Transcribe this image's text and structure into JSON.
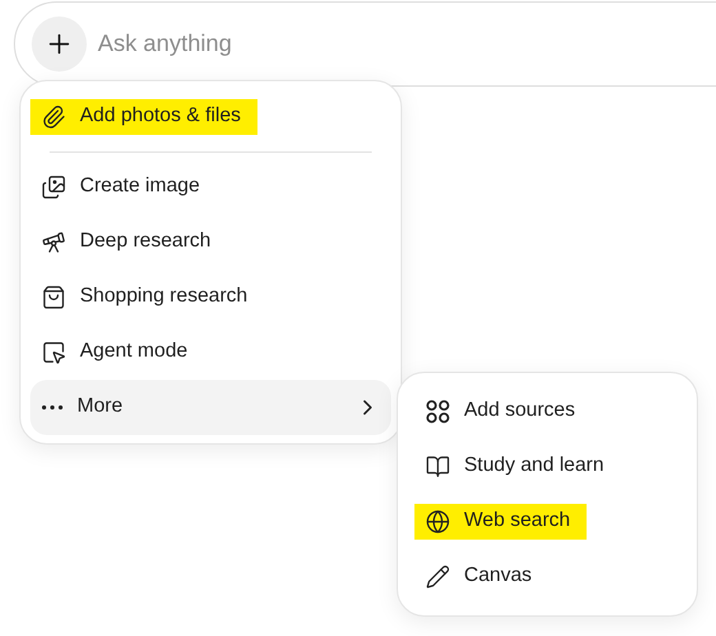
{
  "prompt": {
    "placeholder": "Ask anything"
  },
  "menu": {
    "items": [
      {
        "label": "Add photos & files",
        "highlighted": true,
        "selected": false
      },
      {
        "label": "Create image",
        "highlighted": false,
        "selected": false
      },
      {
        "label": "Deep research",
        "highlighted": false,
        "selected": false
      },
      {
        "label": "Shopping research",
        "highlighted": false,
        "selected": false
      },
      {
        "label": "Agent mode",
        "highlighted": false,
        "selected": false
      },
      {
        "label": "More",
        "highlighted": false,
        "selected": true,
        "submenu": true
      }
    ]
  },
  "submenu": {
    "items": [
      {
        "label": "Add sources",
        "highlighted": false,
        "selected": false
      },
      {
        "label": "Study and learn",
        "highlighted": false,
        "selected": false
      },
      {
        "label": "Web search",
        "highlighted": true,
        "selected": false
      },
      {
        "label": "Canvas",
        "highlighted": false,
        "selected": false
      }
    ]
  }
}
